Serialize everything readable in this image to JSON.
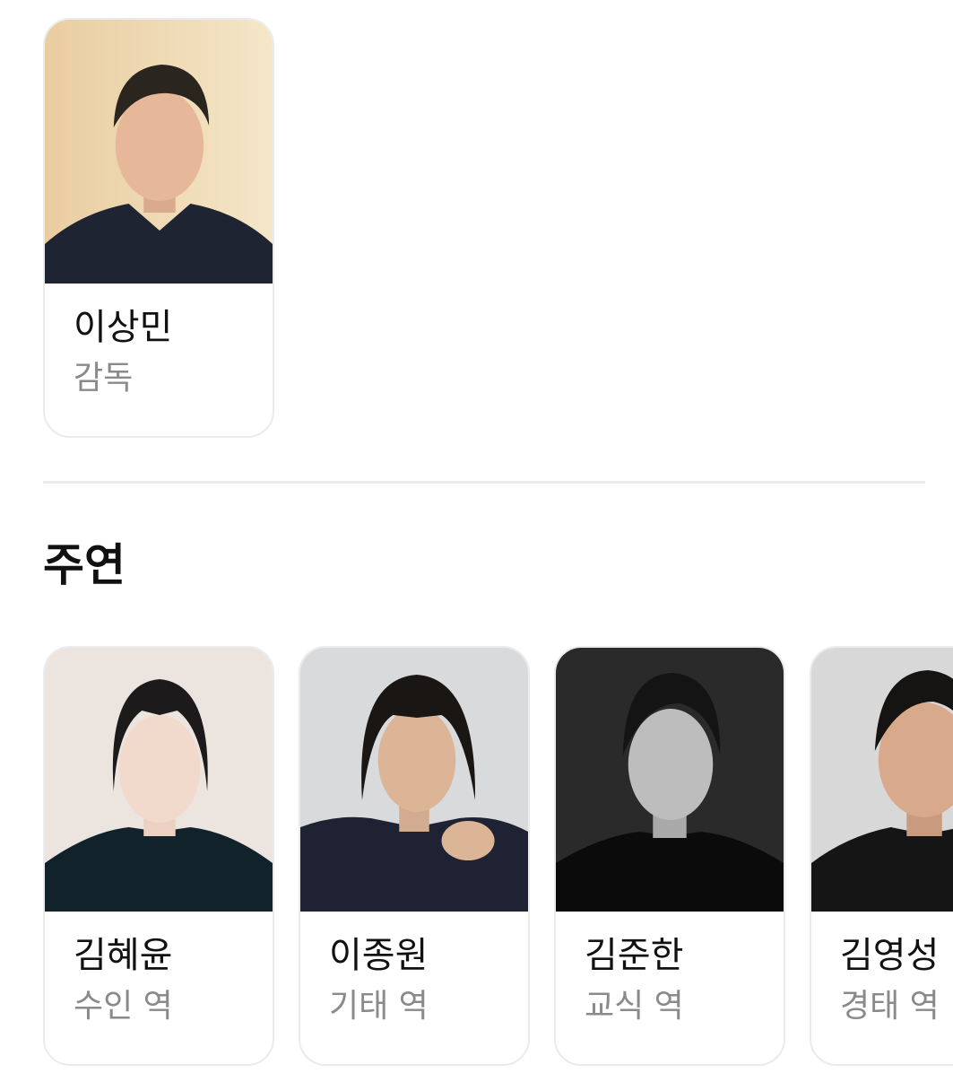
{
  "director": {
    "name": "이상민",
    "role": "감독"
  },
  "cast_section": {
    "title": "주연",
    "members": [
      {
        "name": "김혜윤",
        "role": "수인 역"
      },
      {
        "name": "이종원",
        "role": "기태 역"
      },
      {
        "name": "김준한",
        "role": "교식 역"
      },
      {
        "name": "김영성",
        "role": "경태 역"
      }
    ]
  }
}
